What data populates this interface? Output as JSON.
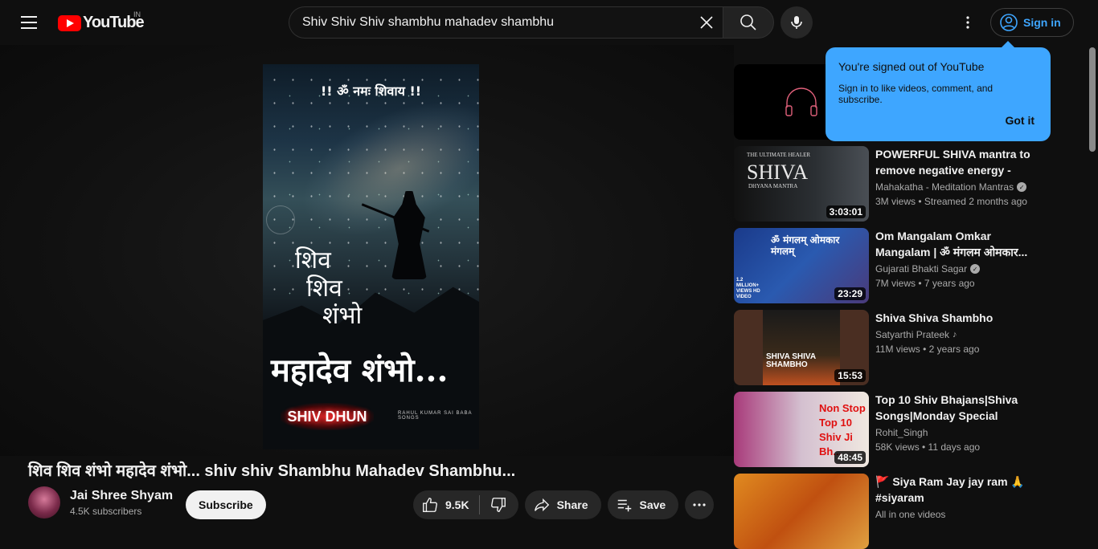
{
  "header": {
    "logo_text": "YouTube",
    "country_code": "IN",
    "search_value": "Shiv Shiv Shiv shambhu mahadev shambhu",
    "search_placeholder": "Search",
    "sign_in_label": "Sign in"
  },
  "popup": {
    "title": "You're signed out of YouTube",
    "text": "Sign in to like videos, comment, and subscribe.",
    "button": "Got it"
  },
  "video": {
    "overlay_top": "!! ॐ नमः शिवाय !!",
    "overlay_lines": [
      "शिव",
      "शिव",
      "शंभो"
    ],
    "overlay_main": "महादेव शंभो...",
    "overlay_badge": "SHIV DHUN",
    "overlay_small": "RAHUL KUMAR SAI BABA SONGS",
    "title": "शिव शिव शंभो महादेव शंभो... shiv shiv Shambhu Mahadev Shambhu...",
    "channel": "Jai Shree Shyam",
    "subscribers": "4.5K subscribers",
    "subscribe_label": "Subscribe",
    "likes": "9.5K",
    "share_label": "Share",
    "save_label": "Save"
  },
  "sidebar": {
    "items": [
      {
        "title": "POWERFUL SHIVA mantra to remove negative energy - Shiv...",
        "channel": "Mahakatha - Meditation Mantras",
        "verified": true,
        "stats": "3M views • Streamed 2 months ago",
        "duration": "3:03:01",
        "thumb_text": "SHIVA",
        "thumb_sub": "THE ULTIMATE HEALER",
        "thumb_sub2": "DHYANA MANTRA"
      },
      {
        "title": "Om Mangalam Omkar Mangalam | ॐ मंगलम ओमकार...",
        "channel": "Gujarati Bhakti Sagar",
        "verified": true,
        "stats": "7M views • 7 years ago",
        "duration": "23:29",
        "thumb_text": "ॐ मंगलम् ओमकार मंगलम्",
        "thumb_sub": "1.2 MILLION+ VIEWS HD VIDEO"
      },
      {
        "title": "Shiva Shiva Shambho",
        "channel": "Satyarthi Prateek",
        "verified": false,
        "stats": "11M views • 2 years ago",
        "duration": "15:53",
        "thumb_text": "SHIVA SHIVA SHAMBHO"
      },
      {
        "title": "Top 10 Shiv Bhajans|Shiva Songs|Monday Special",
        "channel": "Rohit_Singh",
        "verified": false,
        "stats": "58K views • 11 days ago",
        "duration": "48:45",
        "thumb_text": "Non Stop Top 10 Shiv Ji Bh..."
      },
      {
        "title": "🚩 Siya Ram Jay jay ram 🙏 #siyaram",
        "channel": "All in one videos",
        "verified": false,
        "stats": "",
        "duration": ""
      }
    ]
  },
  "colors": {
    "accent": "#3ea6ff",
    "brand": "#ff0000",
    "background": "#0f0f0f"
  }
}
